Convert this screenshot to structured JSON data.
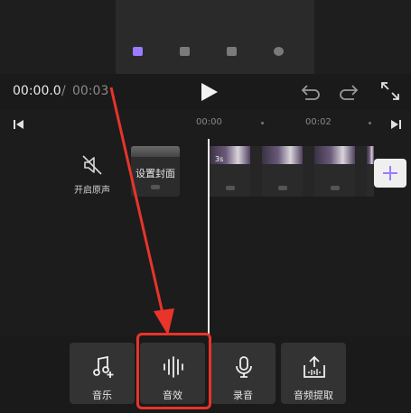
{
  "preview": {
    "tabs": [
      {
        "label": "",
        "icon": "scissors-icon"
      },
      {
        "label": "",
        "icon": "text-icon"
      },
      {
        "label": "",
        "icon": "image-icon"
      },
      {
        "label": "",
        "icon": "sticker-icon"
      }
    ]
  },
  "controls": {
    "current_time": "00:00.0",
    "separator": "/",
    "total_time": "00:03"
  },
  "timeline": {
    "ruler_labels": [
      "00:00",
      "00:02"
    ],
    "original_sound_label": "开启原声",
    "cover_label": "设置封面",
    "clip_duration": "3s",
    "add_button_label": "+"
  },
  "toolbar": {
    "items": [
      {
        "label": "音乐",
        "icon": "music-add-icon"
      },
      {
        "label": "音效",
        "icon": "sound-wave-icon"
      },
      {
        "label": "录音",
        "icon": "microphone-icon"
      },
      {
        "label": "音频提取",
        "icon": "audio-extract-icon"
      }
    ]
  },
  "annotation": {
    "highlight_color": "#e8342a"
  },
  "colors": {
    "accent": "#9b7bff",
    "background": "#1c1c1c",
    "tool_bg": "#333333"
  }
}
